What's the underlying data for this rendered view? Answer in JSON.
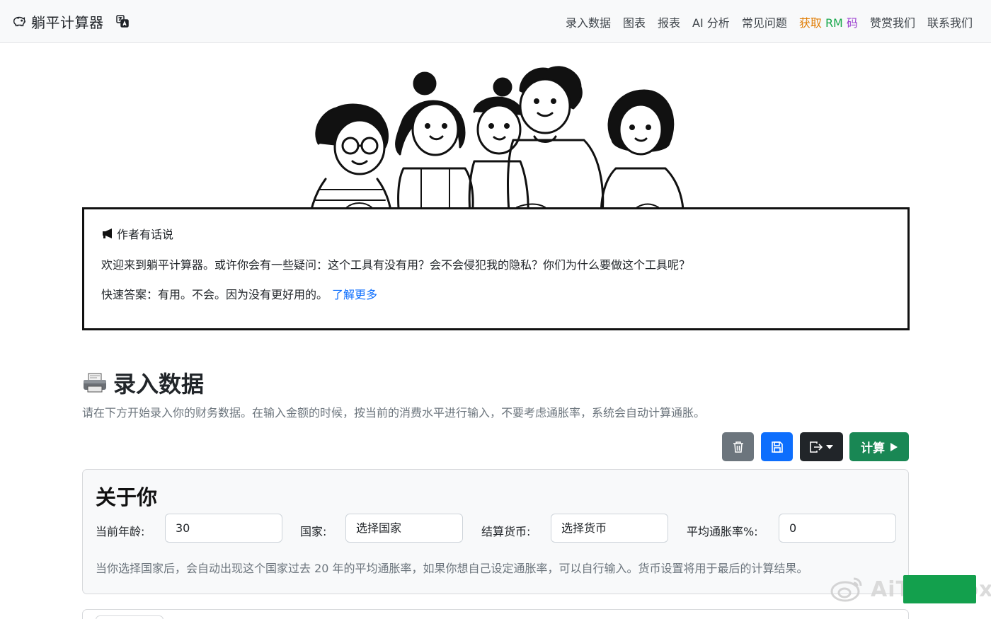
{
  "navbar": {
    "brand": "躺平计算器",
    "links": [
      "录入数据",
      "图表",
      "报表",
      "AI 分析",
      "常见问题"
    ],
    "rm_parts": [
      "获取",
      "RM",
      "码"
    ],
    "links_after": [
      "赞赏我们",
      "联系我们"
    ]
  },
  "author_box": {
    "title": "作者有话说",
    "paragraph1": "欢迎来到躺平计算器。或许你会有一些疑问：这个工具有没有用？会不会侵犯我的隐私？你们为什么要做这个工具呢？",
    "paragraph2": "快速答案：有用。不会。因为没有更好用的。",
    "learn_more": "了解更多"
  },
  "section": {
    "title": "录入数据",
    "description": "请在下方开始录入你的财务数据。在输入金额的时候，按当前的消费水平进行输入，不要考虑通胀率，系统会自动计算通胀。"
  },
  "toolbar": {
    "calculate_label": "计算"
  },
  "about_card": {
    "title": "关于你",
    "age_label": "当前年龄:",
    "age_value": "30",
    "country_label": "国家:",
    "country_value": "选择国家",
    "currency_label": "结算货币:",
    "currency_value": "选择货币",
    "inflation_label": "平均通胀率%:",
    "inflation_value": "0",
    "note": "当你选择国家后，会自动出现这个国家过去 20 年的平均通胀率，如果你想自己设定通胀率，可以自行输入。货币设置将用于最后的计算结果。"
  },
  "watermark": {
    "text": "AiToolBox"
  },
  "colors": {
    "primary": "#0d6efd",
    "secondary": "#6c757d",
    "dark": "#212529",
    "success": "#198754"
  }
}
